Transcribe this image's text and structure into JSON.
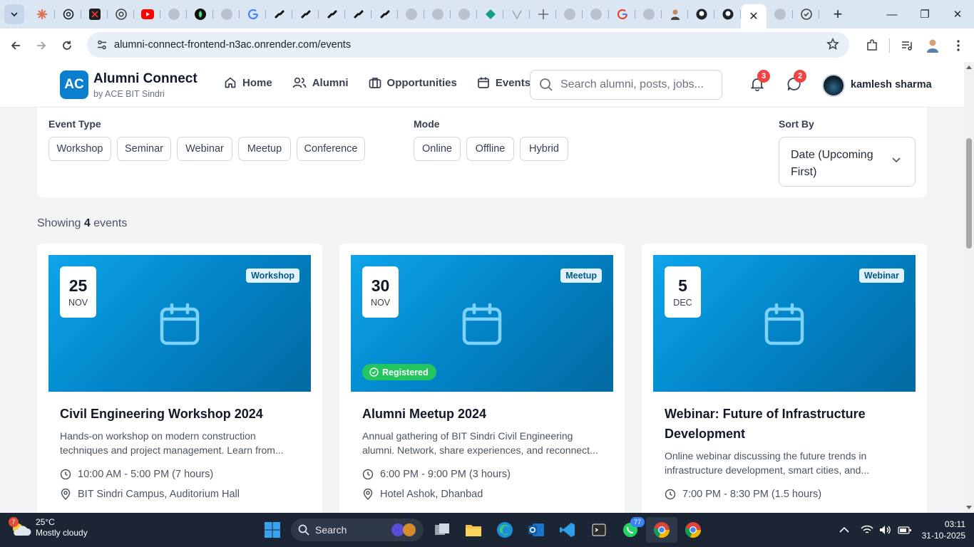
{
  "browser": {
    "active_tab_close": "✕",
    "new_tab": "+",
    "url": "alumni-connect-frontend-n3ac.onrender.com/events"
  },
  "header": {
    "logo_text": "AC",
    "brand_name": "Alumni Connect",
    "brand_sub": "by ACE BIT Sindri",
    "nav": [
      {
        "label": "Home",
        "icon": "home-icon"
      },
      {
        "label": "Alumni",
        "icon": "users-icon"
      },
      {
        "label": "Opportunities",
        "icon": "briefcase-icon"
      },
      {
        "label": "Events",
        "icon": "calendar-icon"
      }
    ],
    "search_placeholder": "Search alumni, posts, jobs...",
    "notifications_count": "3",
    "messages_count": "2",
    "user_name": "kamlesh sharma"
  },
  "filters": {
    "event_type_label": "Event Type",
    "event_types": [
      "Workshop",
      "Seminar",
      "Webinar",
      "Meetup",
      "Conference"
    ],
    "mode_label": "Mode",
    "modes": [
      "Online",
      "Offline",
      "Hybrid"
    ],
    "sort_label": "Sort By",
    "sort_value": "Date (Upcoming First)"
  },
  "results": {
    "prefix": "Showing",
    "count": "4",
    "suffix": "events"
  },
  "events": [
    {
      "day": "25",
      "month": "NOV",
      "type": "Workshop",
      "title": "Civil Engineering Workshop 2024",
      "description": "Hands-on workshop on modern construction techniques and project management. Learn from...",
      "time": "10:00 AM - 5:00 PM (7 hours)",
      "location": "BIT Sindri Campus, Auditorium Hall",
      "registered": false
    },
    {
      "day": "30",
      "month": "NOV",
      "type": "Meetup",
      "title": "Alumni Meetup 2024",
      "description": "Annual gathering of BIT Sindri Civil Engineering alumni. Network, share experiences, and reconnect...",
      "time": "6:00 PM - 9:00 PM (3 hours)",
      "location": "Hotel Ashok, Dhanbad",
      "registered": true,
      "registered_label": "Registered"
    },
    {
      "day": "5",
      "month": "DEC",
      "type": "Webinar",
      "title": "Webinar: Future of Infrastructure Development",
      "description": "Online webinar discussing the future trends in infrastructure development, smart cities, and...",
      "time": "7:00 PM - 8:30 PM (1.5 hours)",
      "registered": false
    }
  ],
  "taskbar": {
    "weather_badge": "7",
    "temperature": "25°C",
    "condition": "Mostly cloudy",
    "search_label": "Search",
    "whatsapp_badge": "77",
    "time": "03:11",
    "date": "31-10-2025"
  },
  "colors": {
    "brand_blue": "#0a7fd0",
    "banner_start": "#0ea5e9",
    "banner_end": "#0369a1",
    "registered_green": "#22c55e",
    "badge_red": "#ef4444"
  }
}
